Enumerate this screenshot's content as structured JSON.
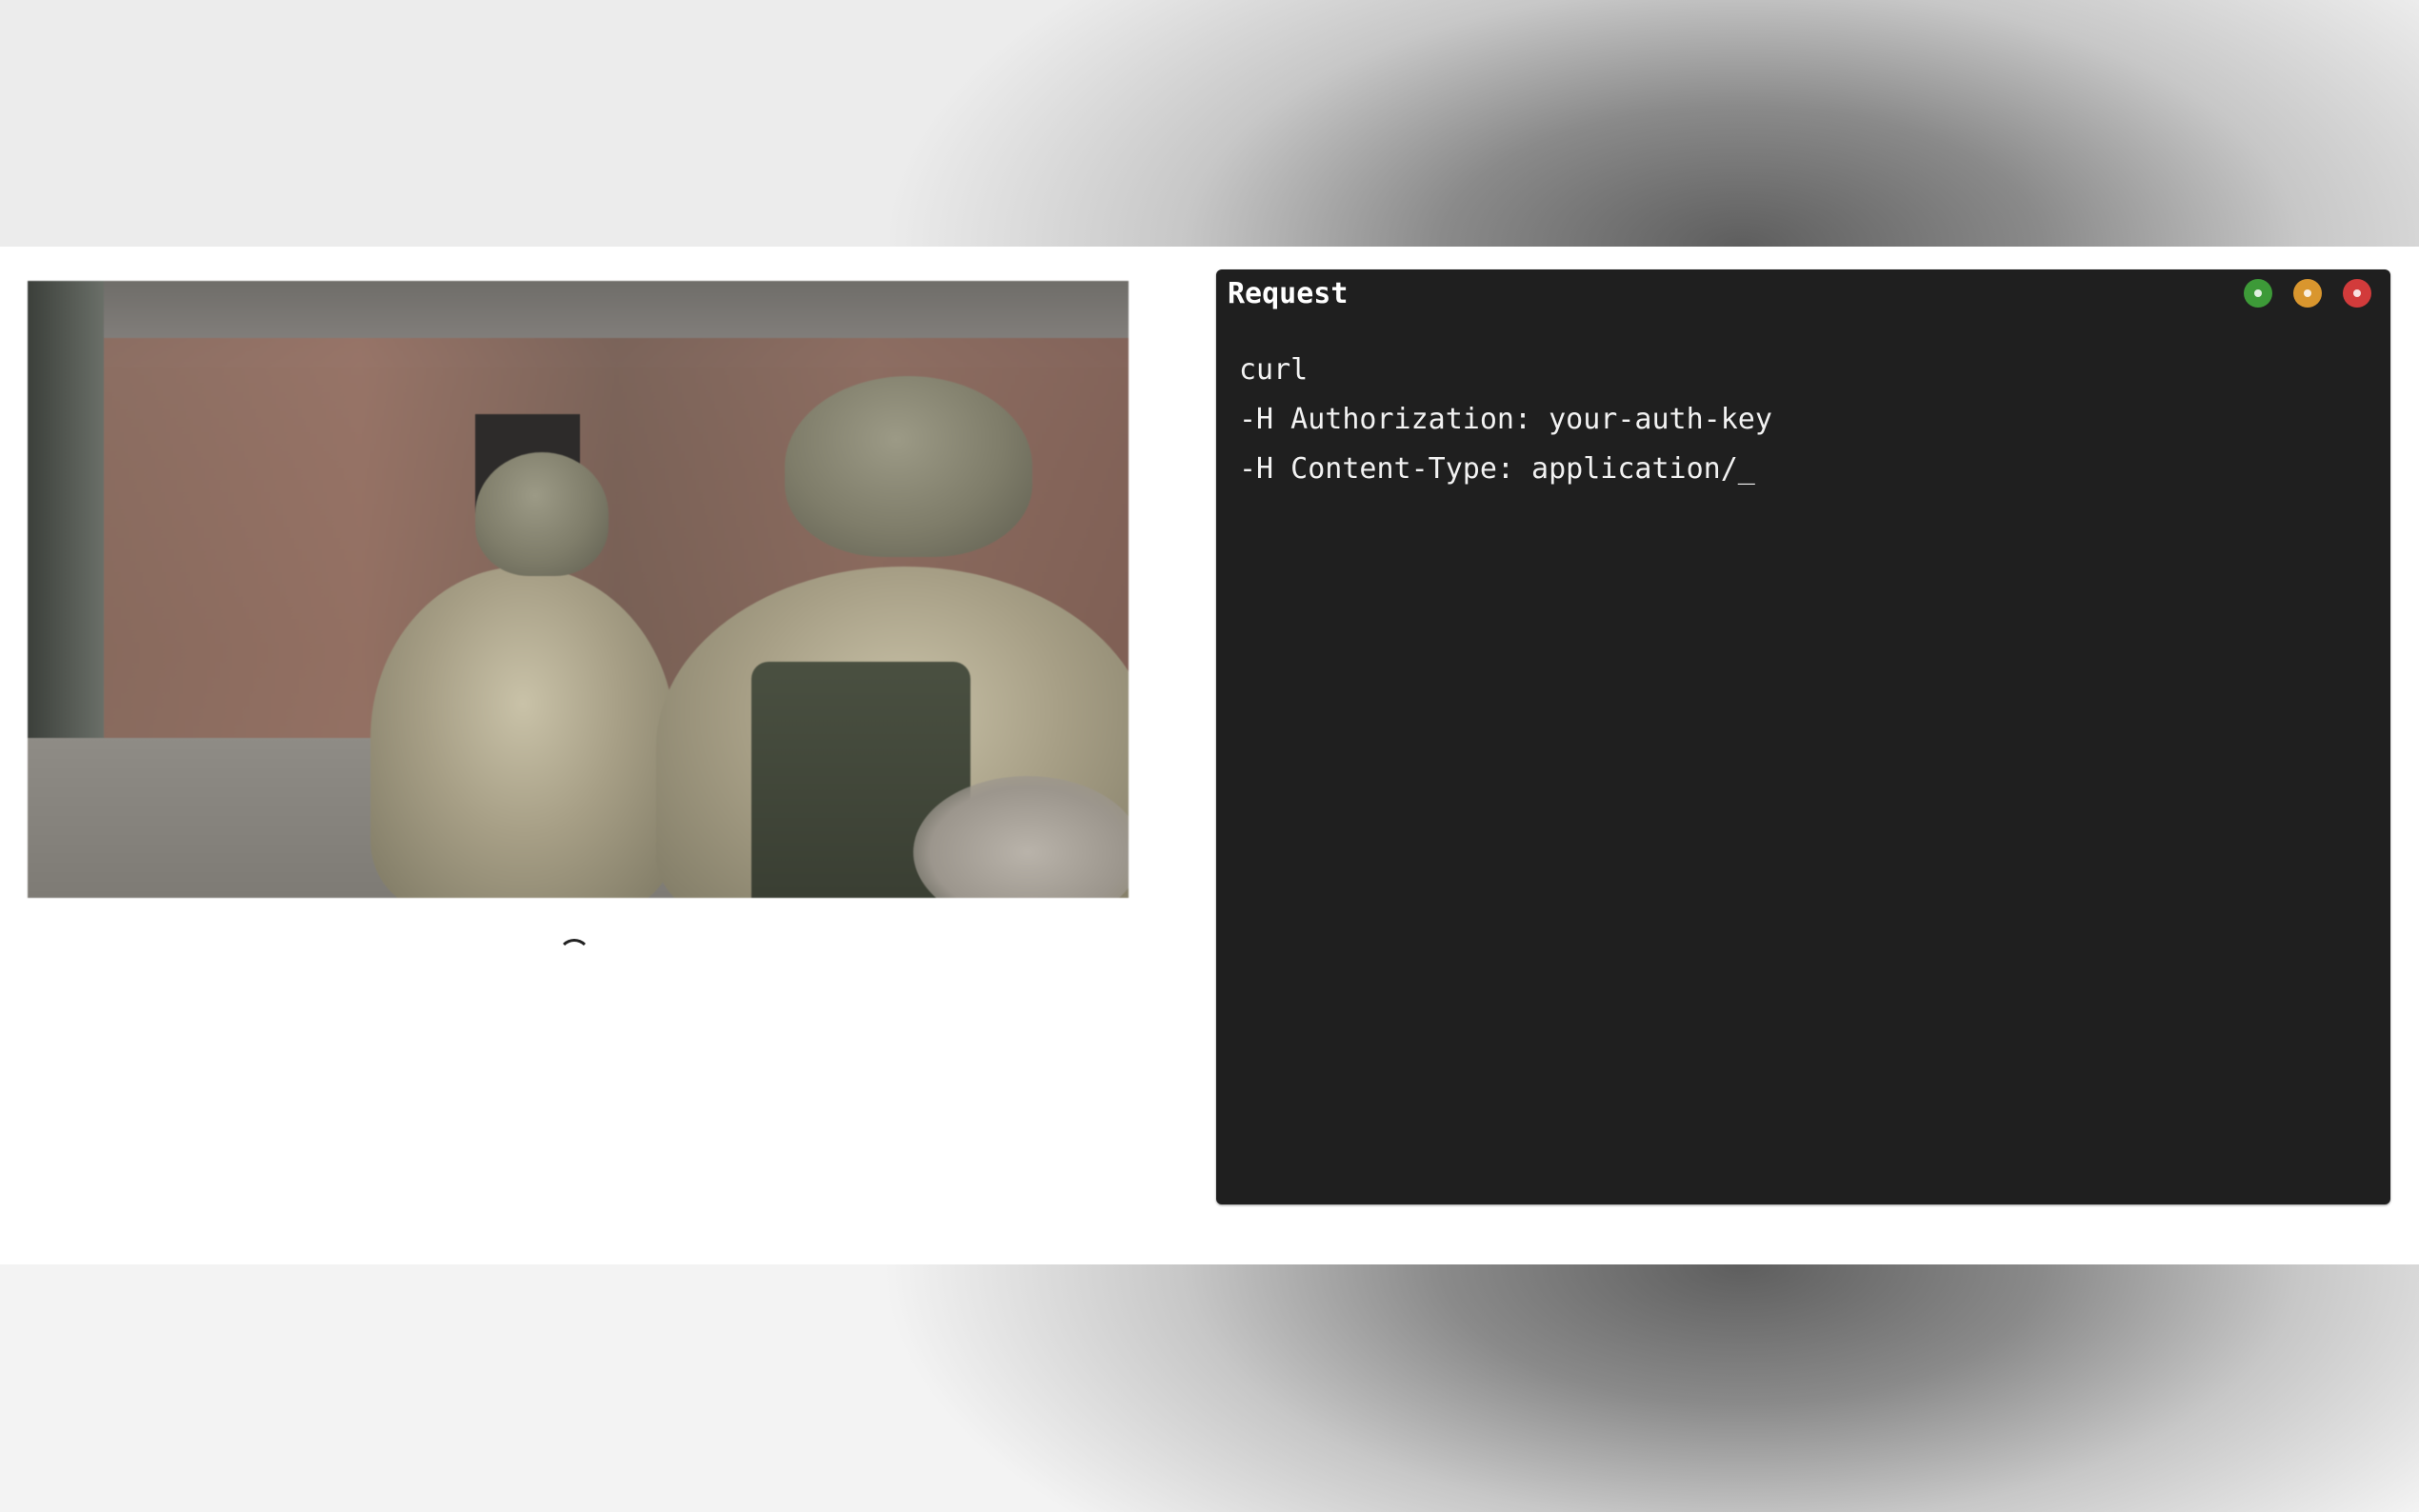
{
  "terminal": {
    "title": "Request",
    "lines": [
      "curl",
      "-H Authorization: your-auth-key",
      "-H Content-Type: application/_"
    ],
    "controls": {
      "green": "#3d9a38",
      "yellow": "#d9962e",
      "red": "#d23b3b"
    },
    "background": "#1f1f1f"
  },
  "media": {
    "image_icon": "soldiers-photo",
    "loading_icon": "spinner-icon"
  }
}
